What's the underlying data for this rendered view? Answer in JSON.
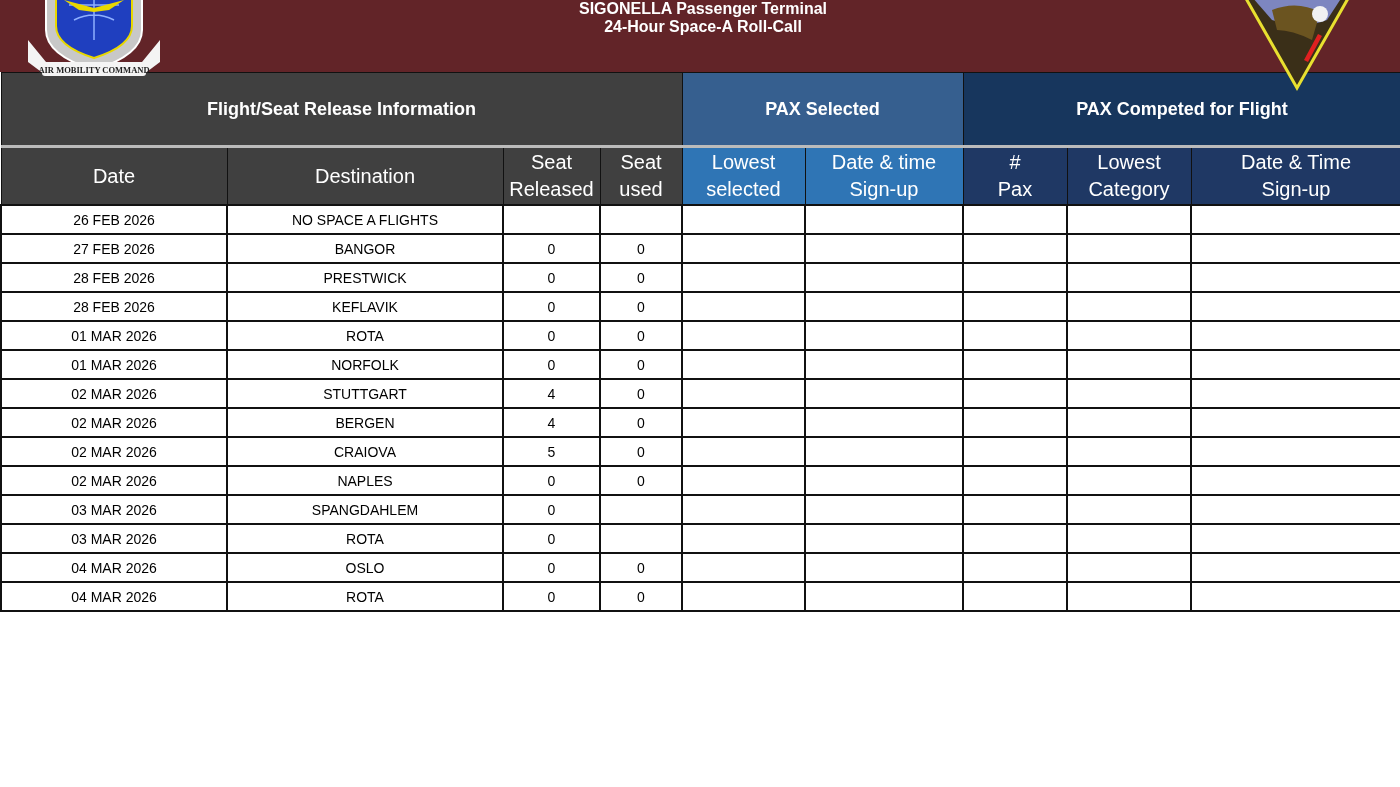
{
  "header": {
    "title_lines": [
      "SIGONELLA Passenger Terminal",
      "24-Hour Space-A Roll-Call"
    ],
    "left_logo_text": "AIR MOBILITY COMMAND"
  },
  "groups": [
    {
      "label": "Flight/Seat Release Information",
      "kind": "grey",
      "columns": [
        {
          "lines": [
            "Date"
          ]
        },
        {
          "lines": [
            "Destination"
          ]
        },
        {
          "lines": [
            "Seat",
            "Released"
          ]
        },
        {
          "lines": [
            "Seat",
            "used"
          ]
        }
      ]
    },
    {
      "label": "PAX Selected",
      "kind": "mid",
      "columns": [
        {
          "lines": [
            "Lowest",
            "selected"
          ]
        },
        {
          "lines": [
            "Date & time",
            "Sign-up"
          ]
        }
      ]
    },
    {
      "label": "PAX Competed for Flight",
      "kind": "dark",
      "columns": [
        {
          "lines": [
            "#",
            "Pax"
          ]
        },
        {
          "lines": [
            "Lowest",
            "Category"
          ]
        },
        {
          "lines": [
            "Date & Time",
            "Sign-up"
          ]
        }
      ]
    }
  ],
  "rows": [
    {
      "date": "26 FEB 2026",
      "destination": "NO SPACE A FLIGHTS"
    },
    {
      "date": "27 FEB 2026",
      "destination": "BANGOR",
      "released": "0",
      "used": "0"
    },
    {
      "date": "28 FEB 2026",
      "destination": "PRESTWICK",
      "released": "0",
      "used": "0"
    },
    {
      "date": "28 FEB 2026",
      "destination": "KEFLAVIK",
      "released": "0",
      "used": "0"
    },
    {
      "date": "01 MAR 2026",
      "destination": "ROTA",
      "released": "0",
      "used": "0"
    },
    {
      "date": "01 MAR 2026",
      "destination": "NORFOLK",
      "released": "0",
      "used": "0"
    },
    {
      "date": "02 MAR 2026",
      "destination": "STUTTGART",
      "released": "4",
      "used": "0"
    },
    {
      "date": "02 MAR 2026",
      "destination": "BERGEN",
      "released": "4",
      "used": "0"
    },
    {
      "date": "02 MAR 2026",
      "destination": "CRAIOVA",
      "released": "5",
      "used": "0"
    },
    {
      "date": "02 MAR 2026",
      "destination": "NAPLES",
      "released": "0",
      "used": "0"
    },
    {
      "date": "03 MAR 2026",
      "destination": "SPANGDAHLEM",
      "released": "0"
    },
    {
      "date": "03 MAR 2026",
      "destination": "ROTA",
      "released": "0"
    },
    {
      "date": "04 MAR 2026",
      "destination": "OSLO",
      "released": "0",
      "used": "0"
    },
    {
      "date": "04 MAR 2026",
      "destination": "ROTA",
      "released": "0",
      "used": "0"
    }
  ]
}
